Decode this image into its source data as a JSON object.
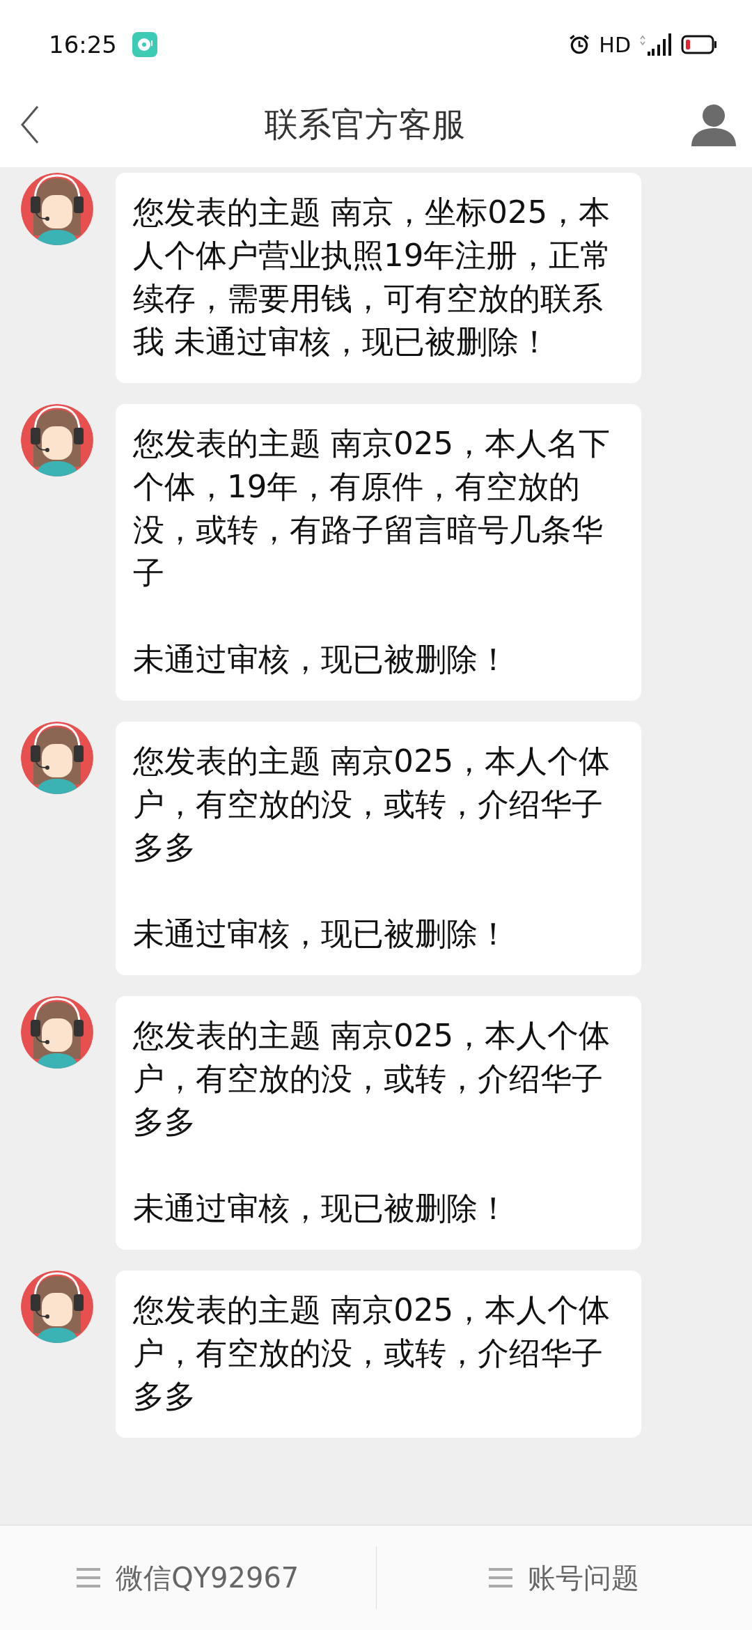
{
  "status_bar": {
    "time": "16:25",
    "network": "HD"
  },
  "header": {
    "title": "联系官方客服"
  },
  "messages": [
    {
      "paragraphs": [
        "您发表的主题 南京，坐标025，本人个体户营业执照19年注册，正常续存，需要用钱，可有空放的联系我 未通过审核，现已被删除！"
      ]
    },
    {
      "paragraphs": [
        "您发表的主题 南京025，本人名下个体，19年，有原件，有空放的没，或转，有路子留言暗号几条华子",
        "未通过审核，现已被删除！"
      ]
    },
    {
      "paragraphs": [
        "您发表的主题 南京025，本人个体户，有空放的没，或转，介绍华子多多",
        "未通过审核，现已被删除！"
      ]
    },
    {
      "paragraphs": [
        "您发表的主题 南京025，本人个体户，有空放的没，或转，介绍华子多多",
        "未通过审核，现已被删除！"
      ]
    },
    {
      "paragraphs": [
        "您发表的主题 南京025，本人个体户，有空放的没，或转，介绍华子多多"
      ]
    }
  ],
  "bottom_menu": [
    {
      "label": "微信QY92967"
    },
    {
      "label": "账号问题"
    }
  ]
}
